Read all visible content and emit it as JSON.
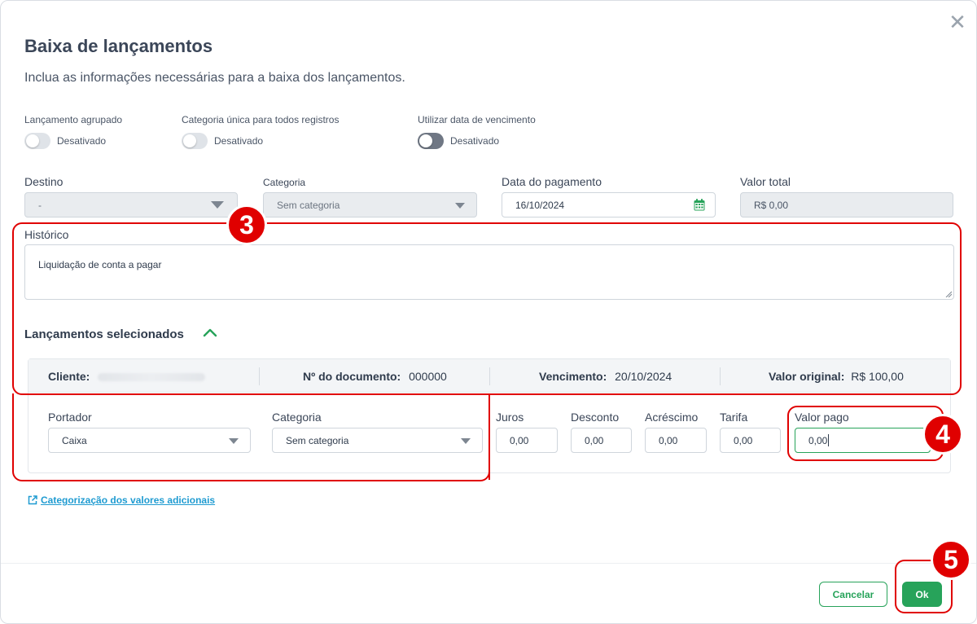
{
  "modal": {
    "title": "Baixa de lançamentos",
    "subtitle": "Inclua as informações necessárias para a baixa dos lançamentos.",
    "close_icon": "close-icon"
  },
  "toggles": [
    {
      "label": "Lançamento agrupado",
      "state": "Desativado"
    },
    {
      "label": "Categoria única para todos registros",
      "state": "Desativado"
    },
    {
      "label": "Utilizar data de vencimento",
      "state": "Desativado"
    }
  ],
  "fields": {
    "destino": {
      "label": "Destino",
      "value": "-"
    },
    "categoria": {
      "label": "Categoria",
      "value": "Sem categoria"
    },
    "data_pagamento": {
      "label": "Data do pagamento",
      "value": "16/10/2024"
    },
    "valor_total": {
      "label": "Valor total",
      "value": "R$ 0,00"
    }
  },
  "historico": {
    "label": "Histórico",
    "value": "Liquidação de conta a pagar"
  },
  "lancamentos": {
    "title": "Lançamentos selecionados",
    "header": {
      "cliente_label": "Cliente:",
      "documento_label": "Nº do documento:",
      "documento_value": "000000",
      "vencimento_label": "Vencimento:",
      "vencimento_value": "20/10/2024",
      "valor_original_label": "Valor original:",
      "valor_original_value": "R$ 100,00"
    },
    "row": {
      "portador_label": "Portador",
      "portador_value": "Caixa",
      "categoria_label": "Categoria",
      "categoria_value": "Sem categoria",
      "juros_label": "Juros",
      "juros_value": "0,00",
      "desconto_label": "Desconto",
      "desconto_value": "0,00",
      "acrescimo_label": "Acréscimo",
      "acrescimo_value": "0,00",
      "tarifa_label": "Tarifa",
      "tarifa_value": "0,00",
      "valor_pago_label": "Valor pago",
      "valor_pago_value": "0,00"
    }
  },
  "link": {
    "label": "Categorização dos valores adicionais"
  },
  "footer": {
    "cancel_label": "Cancelar",
    "ok_label": "Ok"
  },
  "annotations": {
    "step3": "3",
    "step4": "4",
    "step5": "5"
  },
  "colors": {
    "accent": "#27a35a",
    "link": "#1f9bd1",
    "annotation": "#e00000"
  }
}
